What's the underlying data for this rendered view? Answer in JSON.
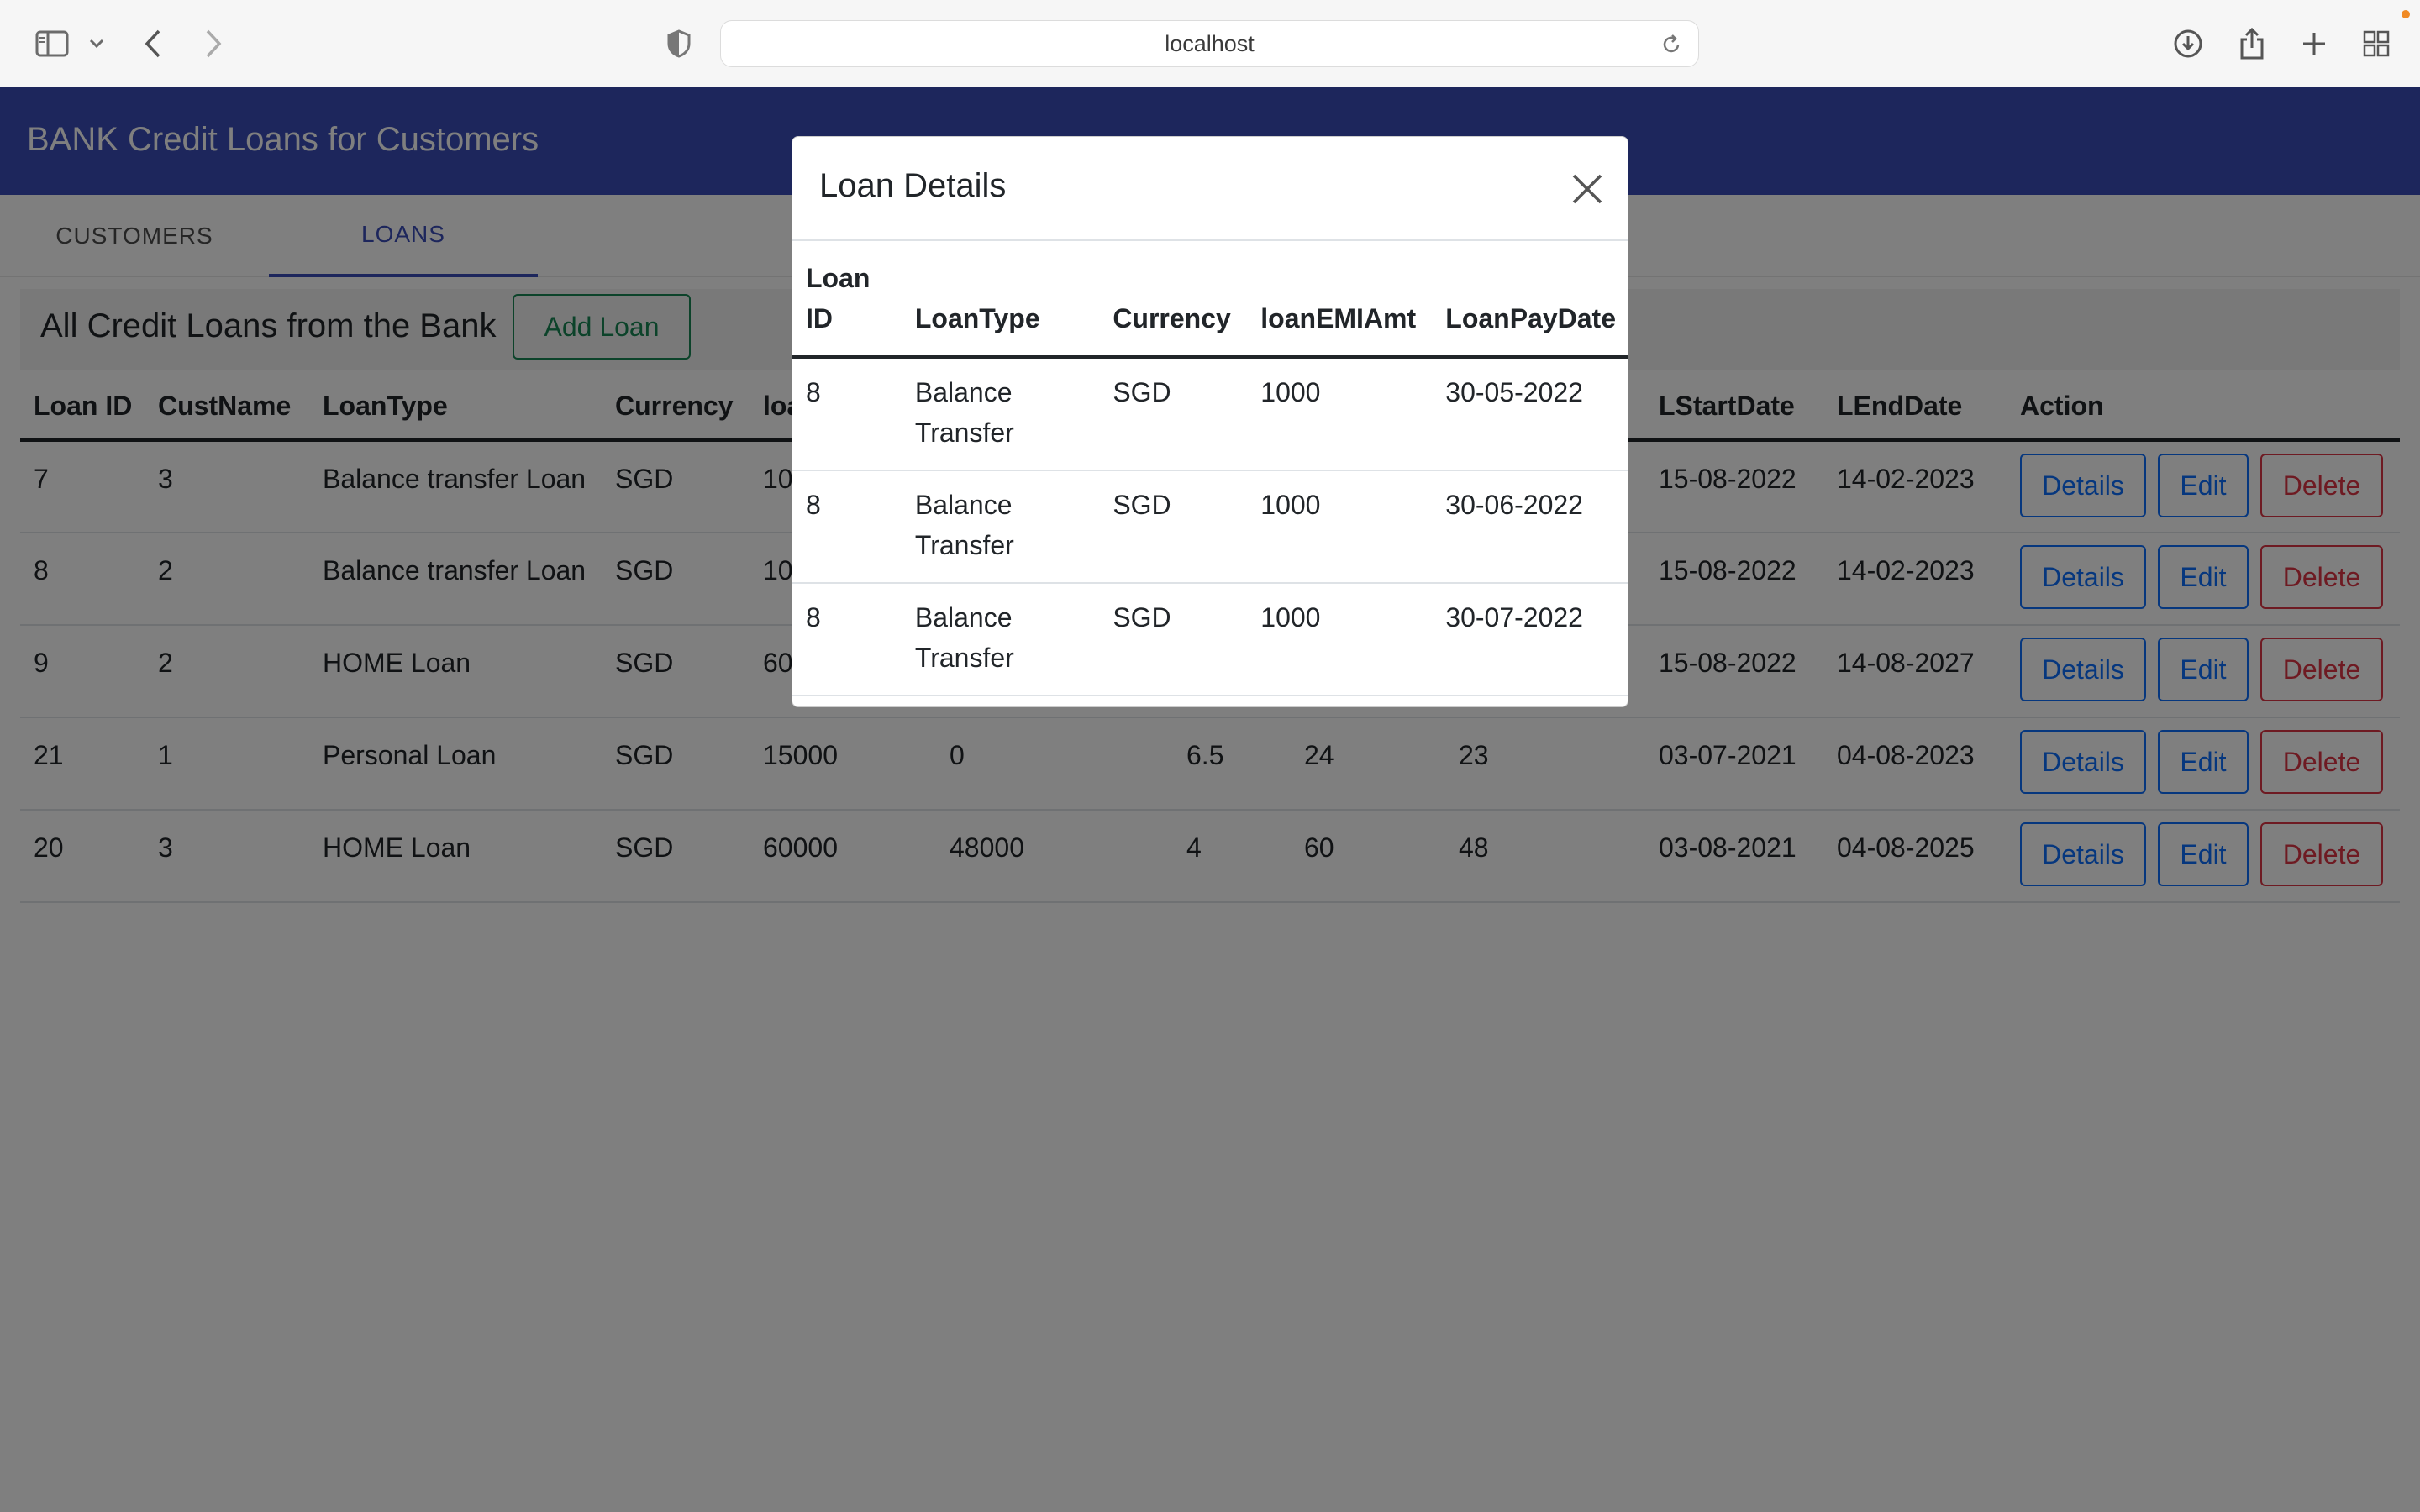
{
  "browser": {
    "url": "localhost"
  },
  "app": {
    "title": "BANK Credit Loans for Customers"
  },
  "tabs": [
    {
      "label": "CUSTOMERS",
      "active": false
    },
    {
      "label": "LOANS",
      "active": true
    }
  ],
  "toolbar": {
    "title": "All Credit Loans from the Bank",
    "add_label": "Add Loan"
  },
  "loans_table": {
    "headers": [
      "Loan ID",
      "CustName",
      "LoanType",
      "Currency",
      "loa",
      "",
      "",
      "",
      "",
      "LStartDate",
      "LEndDate",
      "Action"
    ],
    "rows": [
      {
        "loan_id": "7",
        "cust": "3",
        "type": "Balance transfer Loan",
        "currency": "SGD",
        "amt": "10",
        "c5": "",
        "c6": "",
        "c7": "",
        "c8": "",
        "start": "15-08-2022",
        "end": "14-02-2023"
      },
      {
        "loan_id": "8",
        "cust": "2",
        "type": "Balance transfer Loan",
        "currency": "SGD",
        "amt": "10",
        "c5": "",
        "c6": "",
        "c7": "",
        "c8": "",
        "start": "15-08-2022",
        "end": "14-02-2023"
      },
      {
        "loan_id": "9",
        "cust": "2",
        "type": "HOME Loan",
        "currency": "SGD",
        "amt": "60",
        "c5": "",
        "c6": "",
        "c7": "",
        "c8": "",
        "start": "15-08-2022",
        "end": "14-08-2027"
      },
      {
        "loan_id": "21",
        "cust": "1",
        "type": "Personal Loan",
        "currency": "SGD",
        "amt": "15000",
        "c5": "0",
        "c6": "6.5",
        "c7": "24",
        "c8": "23",
        "start": "03-07-2021",
        "end": "04-08-2023"
      },
      {
        "loan_id": "20",
        "cust": "3",
        "type": "HOME Loan",
        "currency": "SGD",
        "amt": "60000",
        "c5": "48000",
        "c6": "4",
        "c7": "60",
        "c8": "48",
        "start": "03-08-2021",
        "end": "04-08-2025"
      }
    ],
    "actions": {
      "details": "Details",
      "edit": "Edit",
      "delete": "Delete"
    }
  },
  "modal": {
    "title": "Loan Details",
    "headers": [
      "Loan ID",
      "LoanType",
      "Currency",
      "loanEMIAmt",
      "LoanPayDate"
    ],
    "rows": [
      {
        "loan_id": "8",
        "type": "Balance Transfer",
        "currency": "SGD",
        "emi": "1000",
        "pay_date": "30-05-2022"
      },
      {
        "loan_id": "8",
        "type": "Balance Transfer",
        "currency": "SGD",
        "emi": "1000",
        "pay_date": "30-06-2022"
      },
      {
        "loan_id": "8",
        "type": "Balance Transfer",
        "currency": "SGD",
        "emi": "1000",
        "pay_date": "30-07-2022"
      }
    ]
  },
  "colors": {
    "header_bg": "#3a4db8",
    "add_button": "#198754",
    "details_edit": "#0d6efd",
    "delete": "#dc3545"
  }
}
